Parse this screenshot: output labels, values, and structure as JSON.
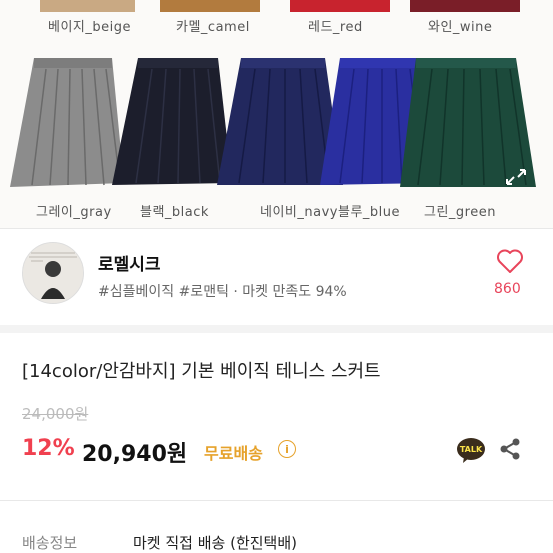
{
  "colors_top": [
    {
      "label": "베이지_beige",
      "hex": "#c9a983"
    },
    {
      "label": "카멜_camel",
      "hex": "#b27b3e"
    },
    {
      "label": "레드_red",
      "hex": "#c8232e"
    },
    {
      "label": "와인_wine",
      "hex": "#7a1e28"
    }
  ],
  "colors_bottom": [
    {
      "label": "그레이_gray",
      "hex": "#8c8c8c"
    },
    {
      "label": "블랙_black",
      "hex": "#1c1e2c"
    },
    {
      "label": "네이비_navy",
      "hex": "#22285e"
    },
    {
      "label": "블루_blue",
      "hex": "#2a2fa0"
    },
    {
      "label": "그린_green",
      "hex": "#1c4a3b"
    }
  ],
  "shop": {
    "name": "로멜시크",
    "subtitle": "#심플베이직 #로맨틱 · 마켓 만족도 94%",
    "likes": "860"
  },
  "product": {
    "title": "[14color/안감바지] 기본 베이직 테니스 스커트",
    "original_price": "24,000원",
    "discount": "12%",
    "price": "20,940원",
    "free_shipping": "무료배송",
    "info_symbol": "i",
    "talk_label": "TALK"
  },
  "shipping": {
    "label": "배송정보",
    "value": "마켓 직접 배송 (한진택배)"
  },
  "theme": {
    "accent": "#f0404f",
    "shipping_color": "#e6a22b"
  }
}
